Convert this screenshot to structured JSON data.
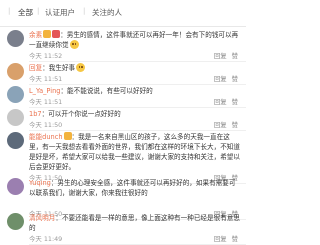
{
  "tabs": [
    {
      "label": "全部"
    },
    {
      "label": "认证用户"
    },
    {
      "label": "关注的人"
    }
  ],
  "actions": {
    "reply": "回复",
    "like": "赞"
  },
  "colors": {
    "username": "#eb7350",
    "time": "#999999",
    "text": "#333333"
  },
  "comments": [
    {
      "user": "余素",
      "text": "：男生的感情，这件事就还可以再好一年！会有下的钱可以再一直继续你觉",
      "time": "今天 11:52",
      "avatar_color": "#7a7f8c",
      "emoji": "smile-icon",
      "badges": [
        "#f3b33d",
        "#e45656"
      ]
    },
    {
      "user": "回复",
      "text": "：我生好事",
      "time": "今天 11:51",
      "avatar_color": "#d9a06b",
      "emoji": "smile-icon",
      "badges": []
    },
    {
      "user": "L_Ya_Ping",
      "text": "：能不能说说，有些可以好好的",
      "time": "今天 11:51",
      "avatar_color": "#8aa3b8",
      "emoji": "",
      "badges": []
    },
    {
      "user": "1b7",
      "text": "：可以开个你说一点好好的",
      "time": "今天 11:50",
      "avatar_color": "#c7c7c7",
      "emoji": "",
      "badges": []
    },
    {
      "user": "能能dunch",
      "text": "：我是一名来自黑山区的孩子，这么多的天我一直在这里，有一天我想去看看外面的世界，我们都在这样的环境下长大，不知道是好是坏，希望大家可以给我一些建议，谢谢大家的支持和关注，希望以后会更好更好。",
      "time": "今天 11:50",
      "avatar_color": "#5d6a7a",
      "emoji": "",
      "badges": [
        "#f3b33d"
      ]
    },
    {
      "user": "Yuqing",
      "text": "：男生的心理安全感，这件事就还可以再好好的，如果有需要可以联系我们，谢谢大家，你来我往很好的",
      "time": "今天 11:50",
      "avatar_color": "#9b7fb0",
      "emoji": "",
      "badges": []
    },
    {
      "user": "清风明月",
      "text": "：不要还能看是一样的意思，像上面这种有一种已经是很有意思的",
      "time": "今天 11:49",
      "avatar_color": "#6f8f6a",
      "emoji": "",
      "badges": []
    }
  ]
}
